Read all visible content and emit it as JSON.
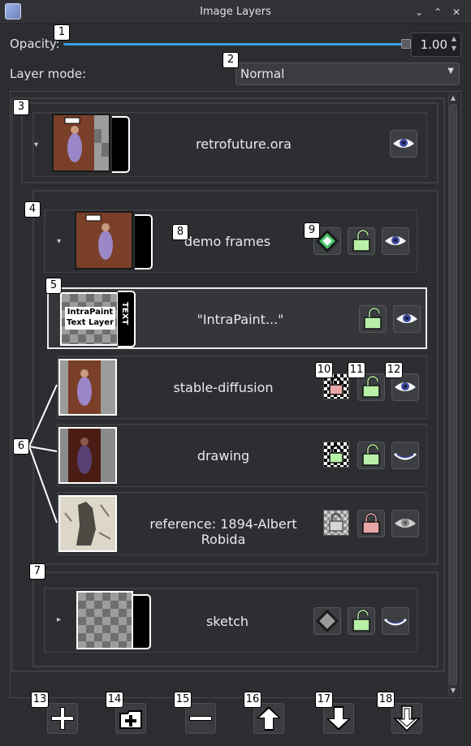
{
  "window": {
    "title": "Image Layers",
    "minimize": "⌄",
    "maximize": "⌃",
    "close": "✕"
  },
  "opacity": {
    "label": "Opacity:",
    "value": "1.00",
    "level": 1.0
  },
  "layer_mode": {
    "label": "Layer mode:",
    "selected": "Normal"
  },
  "layers": {
    "root": {
      "name": "retrofuture.ora"
    },
    "group": {
      "name": "demo frames"
    },
    "text_layer": {
      "name": "\"IntraPaint...\"",
      "thumb_line1": "IntraPaint",
      "thumb_line2": "Text Layer",
      "tab": "TEXT"
    },
    "stable": {
      "name": "stable-diffusion"
    },
    "drawing": {
      "name": "drawing"
    },
    "reference": {
      "name": "reference: 1894-Albert Robida"
    },
    "sketch": {
      "name": "sketch"
    }
  },
  "badges": [
    "1",
    "2",
    "3",
    "4",
    "5",
    "6",
    "7",
    "8",
    "9",
    "10",
    "11",
    "12",
    "13",
    "14",
    "15",
    "16",
    "17",
    "18"
  ],
  "colors": {
    "accent": "#3aa0e3",
    "unlocked": "#b7f0a6",
    "locked": "#e9a6a6",
    "eye": "#3c4a9e"
  }
}
